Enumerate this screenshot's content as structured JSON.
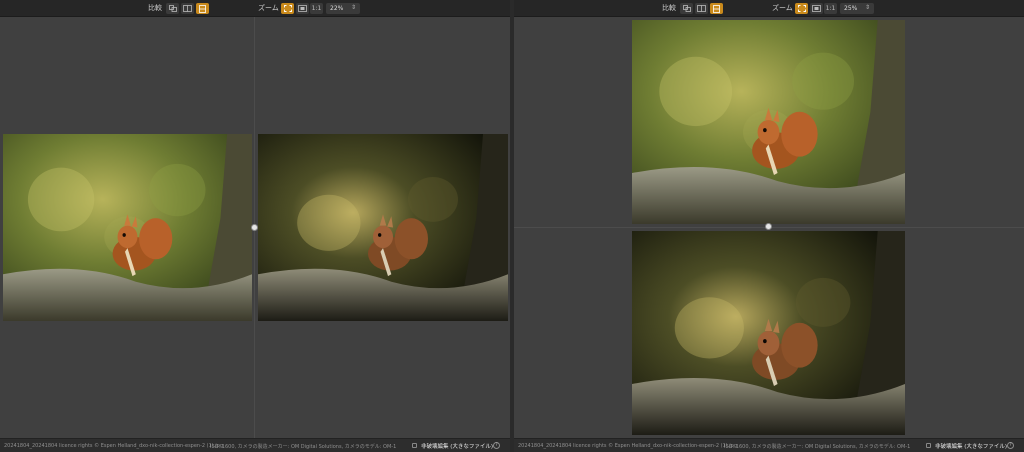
{
  "left_pane": {
    "toolbar": {
      "compare_label": "比較",
      "zoom_label": "ズーム",
      "zoom_1to1": "1:1",
      "zoom_value": "22%",
      "zoom_arrow": "⇕",
      "active_compare_mode": "top-bottom",
      "active_zoom_mode": "fit"
    },
    "status": {
      "file": "20241804_20241804 licence rights © Espen Helland_dxo-nik-collection-espen-2 (1).jpg",
      "meta": "ISO: 1600, カメラの製造メーカー: OM Digital Solutions, カメラのモデル: OM-1",
      "edit_label": "非破壊編集 (大きなファイル)",
      "help": "?"
    }
  },
  "right_pane": {
    "toolbar": {
      "compare_label": "比較",
      "zoom_label": "ズーム",
      "zoom_1to1": "1:1",
      "zoom_value": "25%",
      "zoom_arrow": "⇕",
      "active_compare_mode": "top-bottom",
      "active_zoom_mode": "fit"
    },
    "status": {
      "file": "20241804_20241804 licence rights © Espen Helland_dxo-nik-collection-espen-2 (1).jpg",
      "meta": "ISO: 1600, カメラの製造メーカー: OM Digital Solutions, カメラのモデル: OM-1",
      "edit_label": "非破壊編集 (大きなファイル)",
      "help": "?"
    }
  },
  "colors": {
    "accent": "#c98a1c",
    "toolbar_bg": "#262626",
    "canvas_bg": "#404040"
  }
}
